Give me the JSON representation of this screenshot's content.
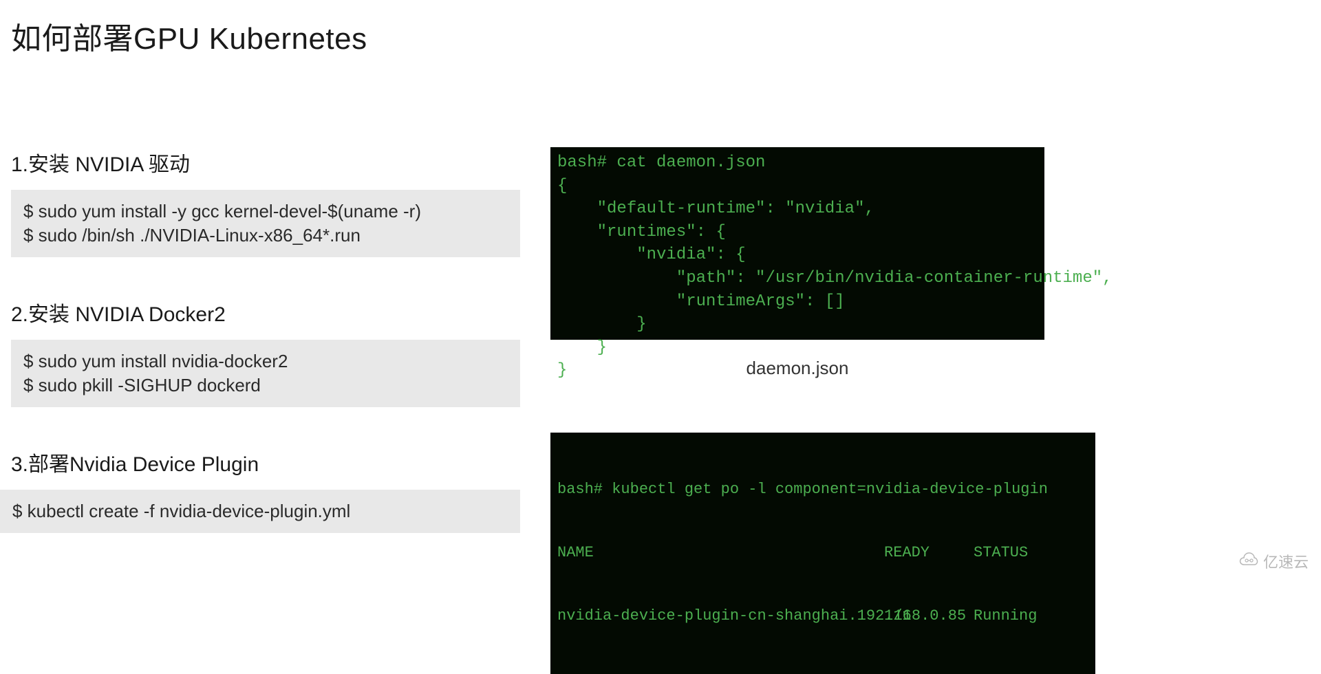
{
  "title": "如何部署GPU Kubernetes",
  "steps": {
    "s1": {
      "heading": "1.安装 NVIDIA 驱动",
      "line1": "$ sudo yum install -y gcc kernel-devel-$(uname -r)",
      "line2": "$ sudo /bin/sh ./NVIDIA-Linux-x86_64*.run"
    },
    "s2": {
      "heading": "2.安装 NVIDIA Docker2",
      "line1": "$ sudo yum install nvidia-docker2",
      "line2": "$ sudo pkill -SIGHUP dockerd"
    },
    "s3": {
      "heading": "3.部署Nvidia Device Plugin",
      "line1": "$ kubectl create -f nvidia-device-plugin.yml"
    }
  },
  "terminal_top": {
    "content": "bash# cat daemon.json\n{\n    \"default-runtime\": \"nvidia\",\n    \"runtimes\": {\n        \"nvidia\": {\n            \"path\": \"/usr/bin/nvidia-container-runtime\",\n            \"runtimeArgs\": []\n        }\n    }\n}",
    "label": "daemon.json"
  },
  "terminal_bottom": {
    "cmd": "bash# kubectl get po -l component=nvidia-device-plugin",
    "headers": {
      "name": "NAME",
      "ready": "READY",
      "status": "STATUS"
    },
    "row": {
      "name": "nvidia-device-plugin-cn-shanghai.192.168.0.85",
      "ready": "1/1",
      "status": "Running"
    }
  },
  "watermark": "亿速云"
}
